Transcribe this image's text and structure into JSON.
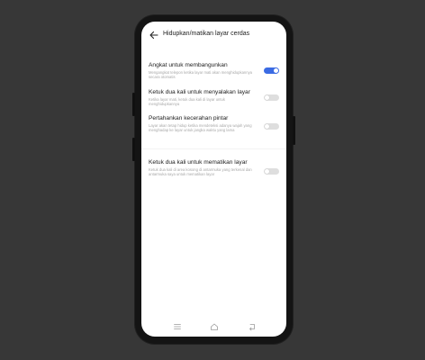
{
  "header": {
    "title": "Hidupkan/matikan layar cerdas"
  },
  "settings": [
    {
      "title": "Angkat untuk membangunkan",
      "desc": "Mengangkat telepon ketika layar mati akan menghidupkannya secara otomatis",
      "state": "on"
    },
    {
      "title": "Ketuk dua kali untuk menyalakan layar",
      "desc": "Ketika layar mati, ketuk dua kali di layar untuk menghidupkannya",
      "state": "off"
    },
    {
      "title": "Pertahankan kecerahan pintar",
      "desc": "Layar akan tetap hidup ketika mendeteksi adanya wajah yang menghadap ke layar untuk jangka waktu yang lama",
      "state": "off"
    },
    {
      "title": "Ketuk dua kali untuk mematikan layar",
      "desc": "Ketuk dua kali di area kosong di antarmuka yang terkenal dan antarmuka saya untuk mematikan layar",
      "state": "off"
    }
  ],
  "colors": {
    "background": "#373737",
    "accent": "#3b6be3",
    "toggle_off": "#dedede"
  },
  "navbar": {
    "icons": [
      "menu-icon",
      "home-icon",
      "back-nav-icon"
    ]
  }
}
